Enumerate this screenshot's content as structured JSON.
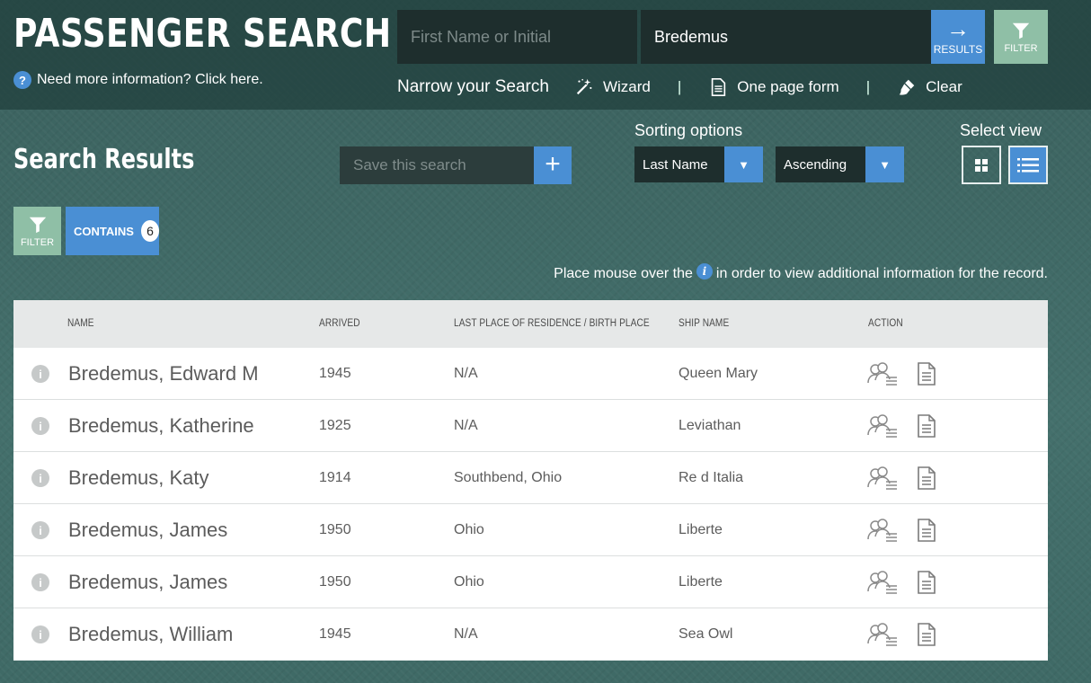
{
  "header": {
    "title": "PASSENGER SEARCH",
    "more_info": "Need more information? Click here.",
    "first_name_placeholder": "First Name or Initial",
    "last_name_value": "Bredemus",
    "results_label": "RESULTS",
    "filter_label": "FILTER"
  },
  "narrow": {
    "label": "Narrow your Search",
    "links": [
      {
        "label": "Wizard",
        "icon": "magic-wand-icon"
      },
      {
        "label": "One page form",
        "icon": "document-icon"
      },
      {
        "label": "Clear",
        "icon": "brush-icon"
      }
    ],
    "separator": "|"
  },
  "results": {
    "title": "Search Results",
    "save_placeholder": "Save this search",
    "sorting_label": "Sorting options",
    "sort_field": "Last Name",
    "sort_order": "Ascending",
    "view_label": "Select view",
    "filter_label": "FILTER",
    "contains_label": "CONTAINS",
    "contains_count": "6",
    "hint_before": "Place mouse over the",
    "hint_after": "in order to view additional information for the record."
  },
  "table": {
    "columns": [
      "NAME",
      "ARRIVED",
      "LAST PLACE OF RESIDENCE / BIRTH PLACE",
      "SHIP NAME",
      "ACTION"
    ],
    "rows": [
      {
        "name": "Bredemus, Edward M",
        "arrived": "1945",
        "residence": "N/A",
        "ship": "Queen Mary"
      },
      {
        "name": "Bredemus, Katherine",
        "arrived": "1925",
        "residence": "N/A",
        "ship": "Leviathan"
      },
      {
        "name": "Bredemus, Katy",
        "arrived": "1914",
        "residence": "Southbend, Ohio",
        "ship": "Re d Italia"
      },
      {
        "name": "Bredemus, James",
        "arrived": "1950",
        "residence": "Ohio",
        "ship": "Liberte"
      },
      {
        "name": "Bredemus, James",
        "arrived": "1950",
        "residence": "Ohio",
        "ship": "Liberte"
      },
      {
        "name": "Bredemus, William",
        "arrived": "1945",
        "residence": "N/A",
        "ship": "Sea Owl"
      }
    ]
  },
  "colors": {
    "accent_blue": "#4a8fd4",
    "filter_green": "#8fbfa6",
    "background": "#3e6663"
  }
}
